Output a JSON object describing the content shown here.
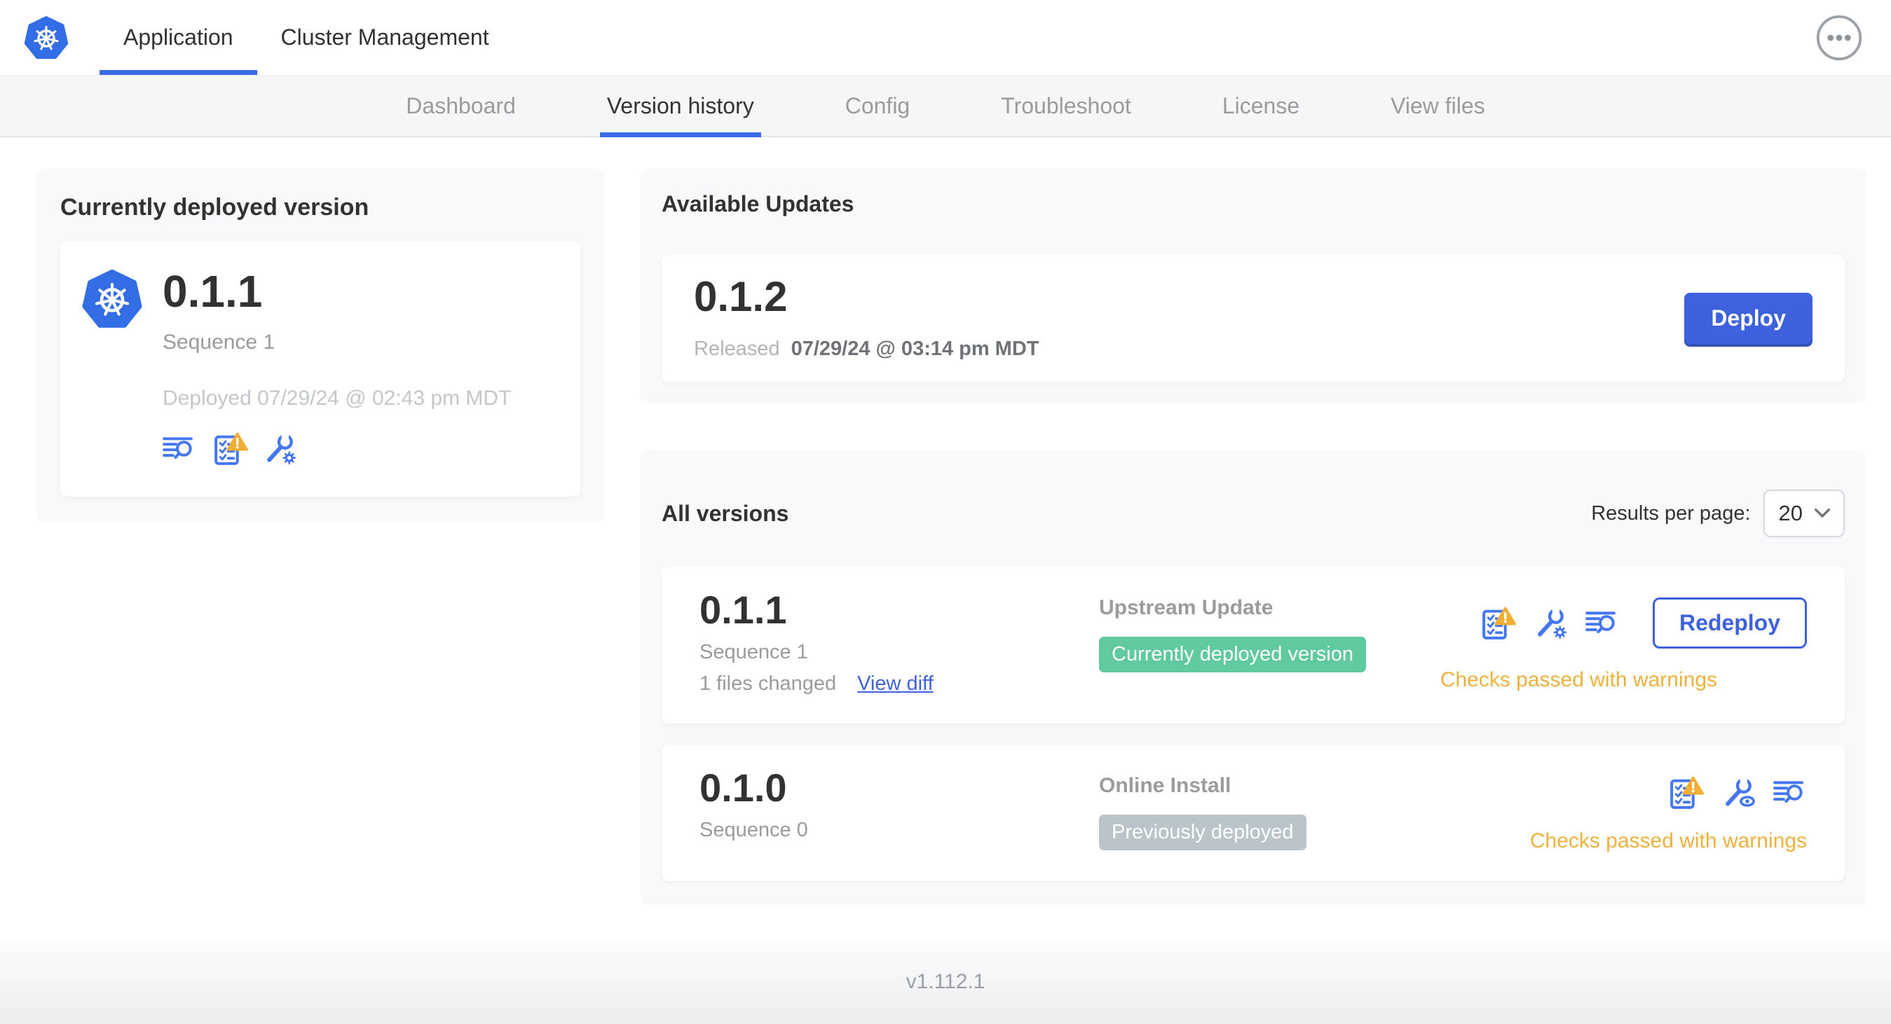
{
  "header": {
    "tabs": [
      {
        "label": "Application",
        "active": true
      },
      {
        "label": "Cluster Management",
        "active": false
      }
    ]
  },
  "subnav": [
    {
      "label": "Dashboard",
      "active": false
    },
    {
      "label": "Version history",
      "active": true
    },
    {
      "label": "Config",
      "active": false
    },
    {
      "label": "Troubleshoot",
      "active": false
    },
    {
      "label": "License",
      "active": false
    },
    {
      "label": "View files",
      "active": false
    }
  ],
  "current_version": {
    "title": "Currently deployed version",
    "version": "0.1.1",
    "sequence": "Sequence 1",
    "deployed": "Deployed 07/29/24 @ 02:43 pm MDT"
  },
  "available_updates": {
    "title": "Available Updates",
    "version": "0.1.2",
    "released_label": "Released",
    "released_date": "07/29/24 @ 03:14 pm MDT",
    "deploy_button": "Deploy"
  },
  "all_versions": {
    "title": "All versions",
    "results_per_page_label": "Results per page:",
    "results_per_page_value": "20",
    "rows": [
      {
        "version": "0.1.1",
        "sequence": "Sequence 1",
        "files_changed": "1 files changed",
        "view_diff_label": "View diff",
        "source": "Upstream Update",
        "badge": "Currently deployed version",
        "badge_type": "green",
        "status": "Checks passed with warnings",
        "action_button": "Redeploy"
      },
      {
        "version": "0.1.0",
        "sequence": "Sequence 0",
        "source": "Online Install",
        "badge": "Previously deployed",
        "badge_type": "gray",
        "status": "Checks passed with warnings"
      }
    ]
  },
  "footer": {
    "version": "v1.112.1"
  },
  "icons": {
    "logo": "kubernetes-wheel",
    "menu": "ellipsis-circle",
    "diff": "lines-magnifier",
    "preflight": "checklist-warning",
    "edit_config": "wrench-gear",
    "view_config": "wrench-eye",
    "select_chevron": "chevron-down"
  },
  "colors": {
    "accent_blue": "#3e62dd",
    "icon_blue": "#4576f2",
    "kubernetes_blue": "#326de6",
    "badge_green": "#61c99e",
    "badge_gray": "#bac4c9",
    "warning_amber": "#edb13d",
    "heading_dark": "#323232",
    "muted_gray": "#9b9b9b"
  }
}
